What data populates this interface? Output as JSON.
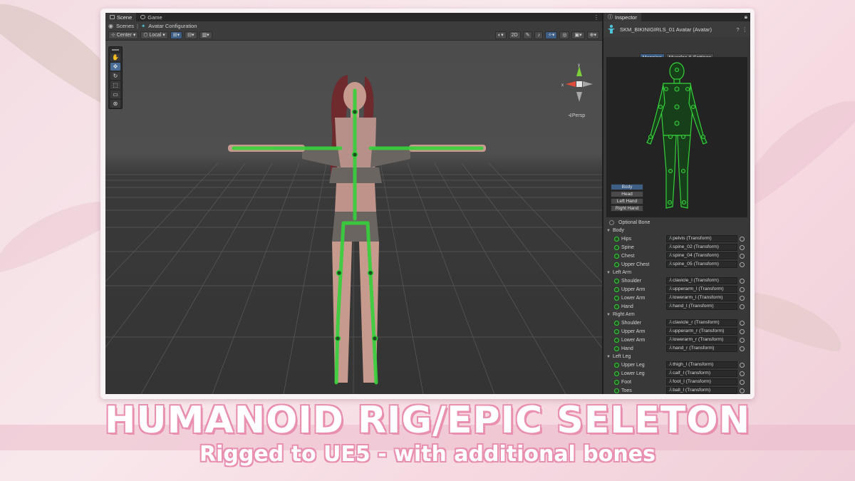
{
  "scene_tabs": [
    {
      "label": "Scene",
      "active": true
    },
    {
      "label": "Game",
      "active": false
    }
  ],
  "breadcrumb": [
    "Scenes",
    "Avatar Configuration"
  ],
  "toolbar": {
    "pivot": "Center",
    "space": "Local",
    "view_2d": "2D"
  },
  "tools": [
    "hand-tool",
    "move-tool",
    "rotate-tool",
    "scale-tool",
    "rect-tool",
    "transform-tool"
  ],
  "persp_label": "Persp",
  "gizmo": {
    "x": "x",
    "y": "y"
  },
  "inspector": {
    "title": "Inspector",
    "object_name": "SKM_BIKINIGIRLS_01 Avatar (Avatar)",
    "tabs": [
      "Mapping",
      "Muscles & Settings"
    ],
    "active_tab": "Mapping",
    "part_buttons": [
      "Body",
      "Head",
      "Left Hand",
      "Right Hand"
    ],
    "active_part": "Body",
    "optional_bone": "Optional Bone",
    "sections": [
      {
        "name": "Body",
        "bones": [
          {
            "label": "Hips",
            "value": "pelvis (Transform)"
          },
          {
            "label": "Spine",
            "value": "spine_02 (Transform)"
          },
          {
            "label": "Chest",
            "value": "spine_04 (Transform)"
          },
          {
            "label": "Upper Chest",
            "value": "spine_05 (Transform)"
          }
        ]
      },
      {
        "name": "Left Arm",
        "bones": [
          {
            "label": "Shoulder",
            "value": "clavicle_l (Transform)"
          },
          {
            "label": "Upper Arm",
            "value": "upperarm_l (Transform)"
          },
          {
            "label": "Lower Arm",
            "value": "lowerarm_l (Transform)"
          },
          {
            "label": "Hand",
            "value": "hand_l (Transform)"
          }
        ]
      },
      {
        "name": "Right Arm",
        "bones": [
          {
            "label": "Shoulder",
            "value": "clavicle_r (Transform)"
          },
          {
            "label": "Upper Arm",
            "value": "upperarm_r (Transform)"
          },
          {
            "label": "Lower Arm",
            "value": "lowerarm_r (Transform)"
          },
          {
            "label": "Hand",
            "value": "hand_r (Transform)"
          }
        ]
      },
      {
        "name": "Left Leg",
        "bones": [
          {
            "label": "Upper Leg",
            "value": "thigh_l (Transform)"
          },
          {
            "label": "Lower Leg",
            "value": "calf_l (Transform)"
          },
          {
            "label": "Foot",
            "value": "foot_l (Transform)"
          },
          {
            "label": "Toes",
            "value": "ball_l (Transform)"
          }
        ]
      }
    ]
  },
  "headline": "HUMANOID RIG/EPIC SELETON",
  "subheadline": "Rigged to UE5 - with additional bones",
  "colors": {
    "bone_green": "#35d13b",
    "accent_blue": "#3d5f86",
    "pink_outline": "#e98fb0"
  }
}
